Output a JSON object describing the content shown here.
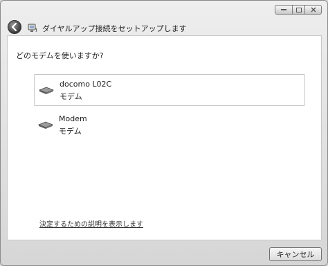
{
  "title": "ダイヤルアップ接続をセットアップします",
  "question": "どのモデムを使いますか?",
  "modems": [
    {
      "name": "docomo L02C",
      "kind": "モデム",
      "icon": "modem-icon"
    },
    {
      "name": "Modem",
      "kind": "モデム",
      "icon": "modem-icon"
    }
  ],
  "help_link": "決定するための説明を表示します",
  "cancel_label": "キャンセル"
}
